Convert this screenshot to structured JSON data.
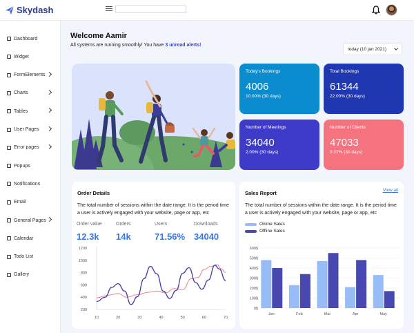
{
  "app": {
    "name": "Skydash"
  },
  "header": {
    "search_value": ""
  },
  "sidebar": {
    "items": [
      {
        "label": "Dashboard",
        "chevron": false
      },
      {
        "label": "Widget",
        "chevron": false
      },
      {
        "label": "FormElements",
        "chevron": true
      },
      {
        "label": "Charts",
        "chevron": true
      },
      {
        "label": "Tables",
        "chevron": true
      },
      {
        "label": "User Pages",
        "chevron": true
      },
      {
        "label": "Error pages",
        "chevron": true
      },
      {
        "label": "Popups",
        "chevron": false
      },
      {
        "label": "Notifications",
        "chevron": false
      },
      {
        "label": "Email",
        "chevron": false
      },
      {
        "label": "General Pages",
        "chevron": true
      },
      {
        "label": "Calendar",
        "chevron": false
      },
      {
        "label": "Todo List",
        "chevron": false
      },
      {
        "label": "Gallery",
        "chevron": false
      }
    ]
  },
  "welcome": {
    "title": "Welcome Aamir",
    "subtitle": "All systems are running smoothly! You have",
    "alert_link": "3 unread alerts!"
  },
  "date_filter": {
    "value": "today (10 jan 2021)"
  },
  "stats": [
    {
      "title": "Today's Bookings",
      "value": "4006",
      "sub": "10.00% (30 days)",
      "color": "#0a8ccf"
    },
    {
      "title": "Total Bookings",
      "value": "61344",
      "sub": "22.00% (30 days)",
      "color": "#1f37b0"
    },
    {
      "title": "Number of Meetings",
      "value": "34040",
      "sub": "2.00% (30 days)",
      "color": "#3f3bc9"
    },
    {
      "title": "Number of Clients",
      "value": "47033",
      "sub": "0.22% (30 days)",
      "color": "#f5737f"
    }
  ],
  "order_details": {
    "title": "Order Details",
    "description": "The total number of sessions within the date range. It is the period time a user is actively engaged with your website, page or app, etc",
    "metrics": [
      {
        "label": "Order value",
        "value": "12.3k"
      },
      {
        "label": "Orders",
        "value": "14k"
      },
      {
        "label": "Users",
        "value": "71.56%"
      },
      {
        "label": "Downloads",
        "value": "34040"
      }
    ]
  },
  "sales_report": {
    "title": "Sales Report",
    "view_all": "View all",
    "description": "The total number of sessions within the date range. It is the period time a user is actively engaged with your website, page or app, etc",
    "legend": [
      {
        "name": "Online Sales",
        "color": "#98bdf6"
      },
      {
        "name": "Offline Sales",
        "color": "#4848b0"
      }
    ]
  },
  "chart_data": [
    {
      "type": "line",
      "title": "",
      "xlabel": "",
      "ylabel": "",
      "x": [
        10,
        20,
        30,
        40,
        50,
        60,
        70
      ],
      "xlim": [
        10,
        70
      ],
      "ylim": [
        200,
        1200
      ],
      "yticks": [
        200,
        400,
        600,
        800,
        1000,
        1200
      ],
      "series": [
        {
          "color": "#e8808a",
          "points": [
            [
              10,
              390
            ],
            [
              15,
              430
            ],
            [
              20,
              460
            ],
            [
              24,
              400
            ],
            [
              29,
              440
            ],
            [
              34,
              480
            ],
            [
              38,
              500
            ],
            [
              42,
              470
            ],
            [
              46,
              540
            ],
            [
              50,
              520
            ],
            [
              54,
              700
            ],
            [
              57,
              720
            ],
            [
              60,
              850
            ],
            [
              63,
              900
            ],
            [
              66,
              930
            ],
            [
              68,
              860
            ],
            [
              70,
              800
            ]
          ]
        },
        {
          "color": "#4a3aa8",
          "points": [
            [
              10,
              330
            ],
            [
              14,
              400
            ],
            [
              17,
              560
            ],
            [
              20,
              620
            ],
            [
              23,
              500
            ],
            [
              26,
              280
            ],
            [
              29,
              410
            ],
            [
              32,
              700
            ],
            [
              35,
              900
            ],
            [
              38,
              780
            ],
            [
              41,
              500
            ],
            [
              44,
              380
            ],
            [
              47,
              510
            ],
            [
              50,
              790
            ],
            [
              53,
              880
            ],
            [
              56,
              640
            ],
            [
              59,
              530
            ],
            [
              62,
              680
            ],
            [
              65,
              920
            ],
            [
              67,
              860
            ],
            [
              70,
              670
            ]
          ]
        }
      ]
    },
    {
      "type": "bar",
      "title": "",
      "xlabel": "",
      "ylabel": "",
      "categories": [
        "Jan",
        "Feb",
        "Mar",
        "Apr",
        "May"
      ],
      "ylim": [
        0,
        600
      ],
      "yticks": [
        "0$",
        "100$",
        "200$",
        "300$",
        "400$",
        "500$",
        "600$"
      ],
      "series": [
        {
          "name": "Online Sales",
          "color": "#98bdf6",
          "values": [
            480,
            230,
            470,
            210,
            330
          ]
        },
        {
          "name": "Offline Sales",
          "color": "#4848b0",
          "values": [
            400,
            340,
            550,
            480,
            170
          ]
        }
      ]
    }
  ]
}
